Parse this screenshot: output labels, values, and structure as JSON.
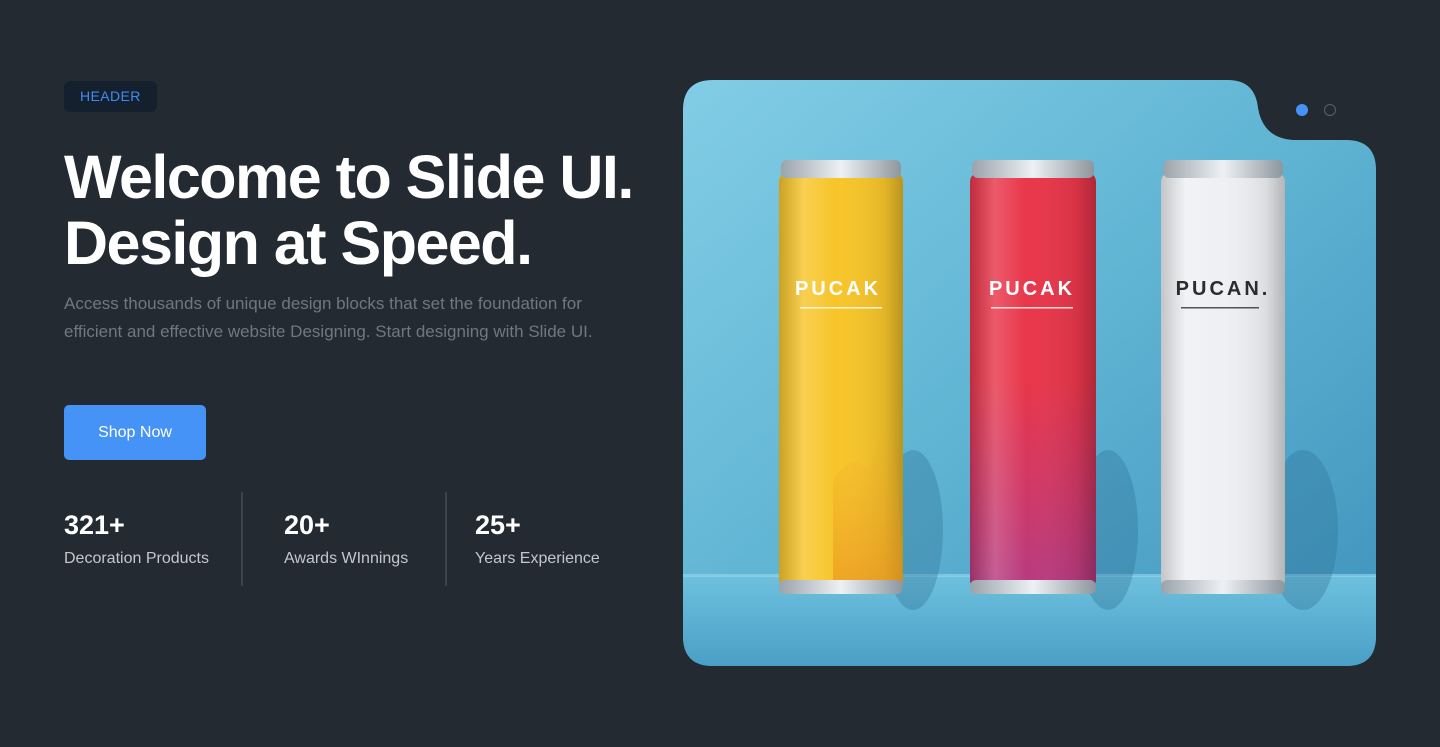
{
  "header": {
    "badge": "HEADER",
    "title": "Welcome to Slide UI. Design at Speed.",
    "subtitle": "Access thousands of unique design blocks that set the foundation for efficient and effective website Designing. Start designing with Slide UI.",
    "cta_label": "Shop Now"
  },
  "stats": [
    {
      "value": "321+",
      "label": "Decoration Products"
    },
    {
      "value": "20+",
      "label": "Awards WInnings"
    },
    {
      "value": "25+",
      "label": "Years Experience"
    }
  ],
  "hero": {
    "cans": [
      {
        "brand": "PUCAK",
        "color": "#f7c52a",
        "text_color": "#ffffff"
      },
      {
        "brand": "PUCAK",
        "color": "#e8364a",
        "text_color": "#ffffff"
      },
      {
        "brand": "PUCAN.",
        "color": "#eef0f3",
        "text_color": "#2c2c2c"
      }
    ],
    "background_color": "#5fb4d3"
  },
  "carousel": {
    "active_index": 0,
    "count": 2
  },
  "colors": {
    "page_background": "#232a31",
    "accent": "#4593f7"
  }
}
